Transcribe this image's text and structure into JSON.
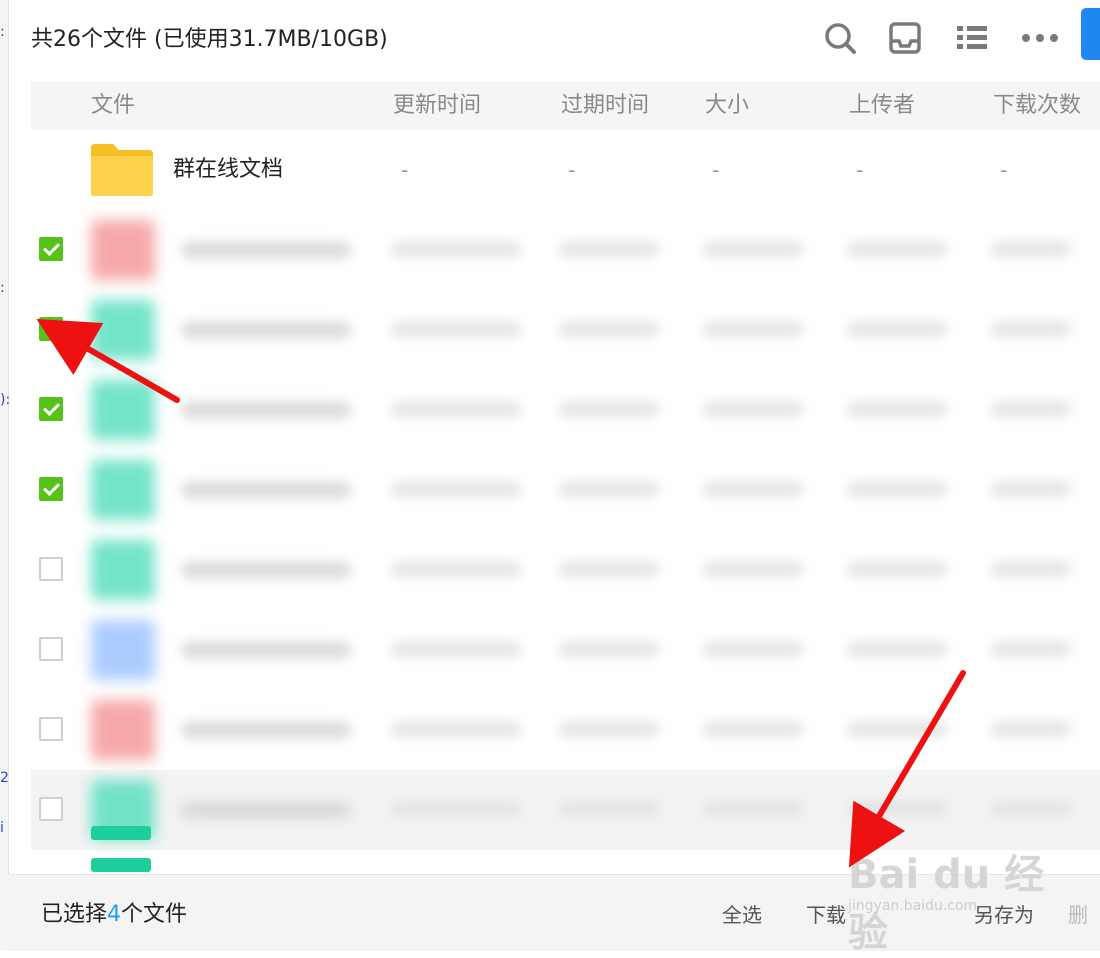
{
  "header": {
    "title": "共26个文件 (已使用31.7MB/10GB)"
  },
  "toolbar": {
    "icons": [
      "search-icon",
      "inbox-icon",
      "list-view-icon",
      "more-icon"
    ]
  },
  "columns": {
    "file": "文件",
    "updated": "更新时间",
    "expires": "过期时间",
    "size": "大小",
    "uploader": "上传者",
    "downloads": "下载次数"
  },
  "folder": {
    "name": "群在线文档",
    "updated": "-",
    "expires": "-",
    "size": "-",
    "uploader": "-",
    "downloads": "-"
  },
  "rows": [
    {
      "checked": true,
      "icon_color": "#f59a9a"
    },
    {
      "checked": true,
      "icon_color": "#5ce0c0"
    },
    {
      "checked": true,
      "icon_color": "#5ce0c0"
    },
    {
      "checked": true,
      "icon_color": "#5ce0c0"
    },
    {
      "checked": false,
      "icon_color": "#5ce0c0"
    },
    {
      "checked": false,
      "icon_color": "#9ec4ff"
    },
    {
      "checked": false,
      "icon_color": "#f59a9a"
    },
    {
      "checked": false,
      "icon_color": "#5ce0c0"
    }
  ],
  "footer": {
    "selected_prefix": "已选择",
    "selected_count": "4",
    "selected_suffix": "个文件",
    "select_all": "全选",
    "download": "下载",
    "save_as": "另存为",
    "delete": "删"
  },
  "watermark": {
    "logo": "Bai du 经验",
    "url": "jingyan.baidu.com"
  },
  "colors": {
    "accent": "#1e9ff2",
    "checkbox_checked": "#52c41a",
    "arrow": "#ee1111",
    "primary_button": "#1e88f0"
  }
}
